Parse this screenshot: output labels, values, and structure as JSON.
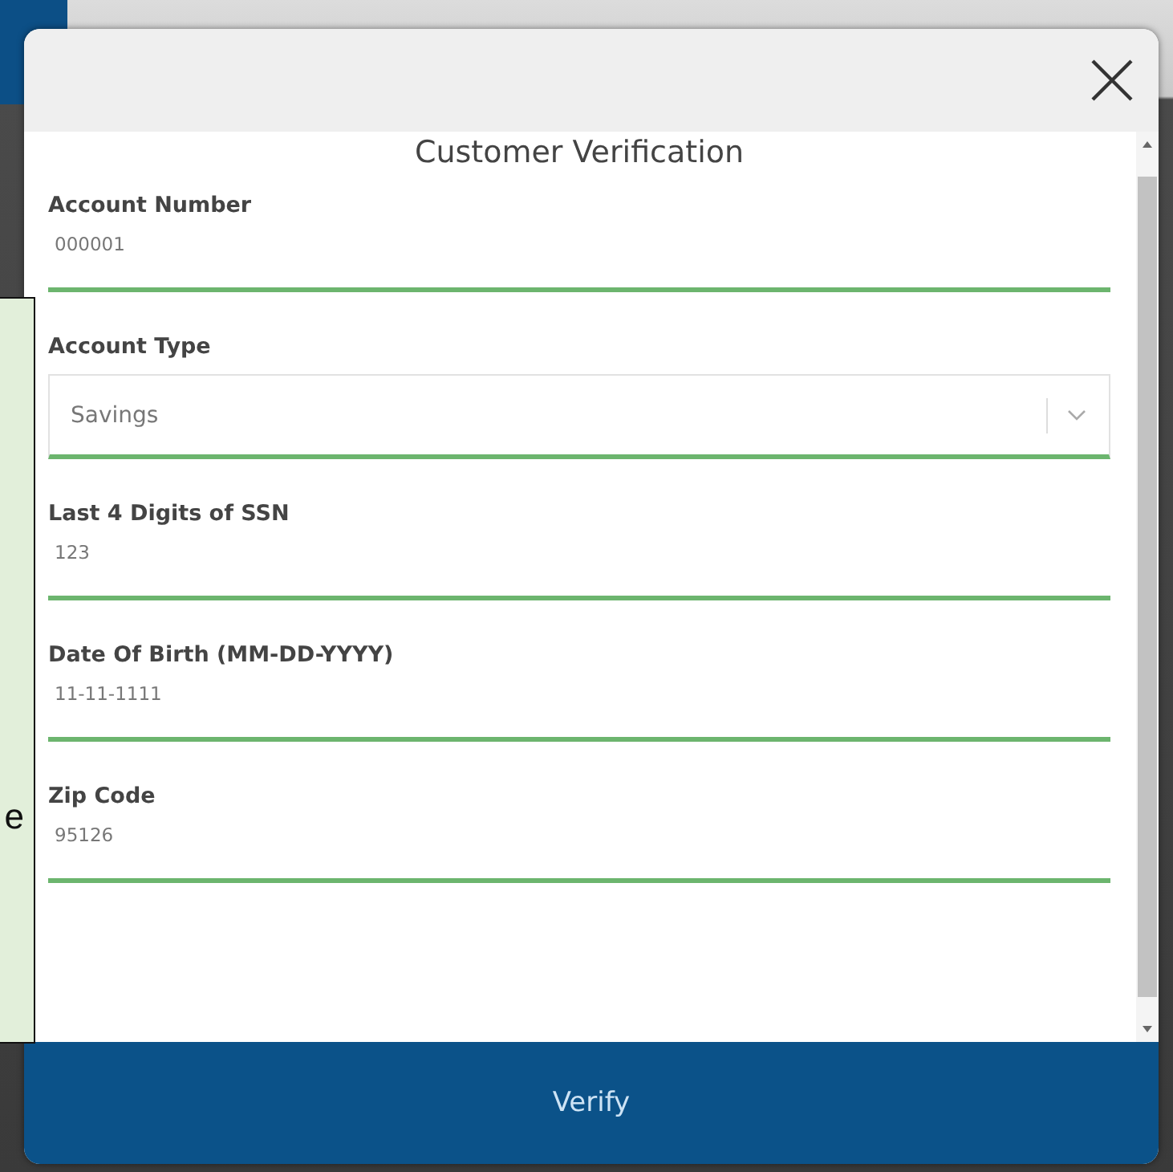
{
  "note": {
    "text": "e"
  },
  "dialog": {
    "title": "Customer Verification",
    "fields": [
      {
        "kind": "text",
        "label": "Account Number",
        "value": "000001"
      },
      {
        "kind": "select",
        "label": "Account Type",
        "value": "Savings"
      },
      {
        "kind": "text",
        "label": "Last 4 Digits of SSN",
        "value": "123"
      },
      {
        "kind": "text",
        "label": "Date Of Birth (MM-DD-YYYY)",
        "value": "11-11-1111"
      },
      {
        "kind": "text",
        "label": "Zip Code",
        "value": "95126"
      }
    ],
    "button": "Verify"
  }
}
